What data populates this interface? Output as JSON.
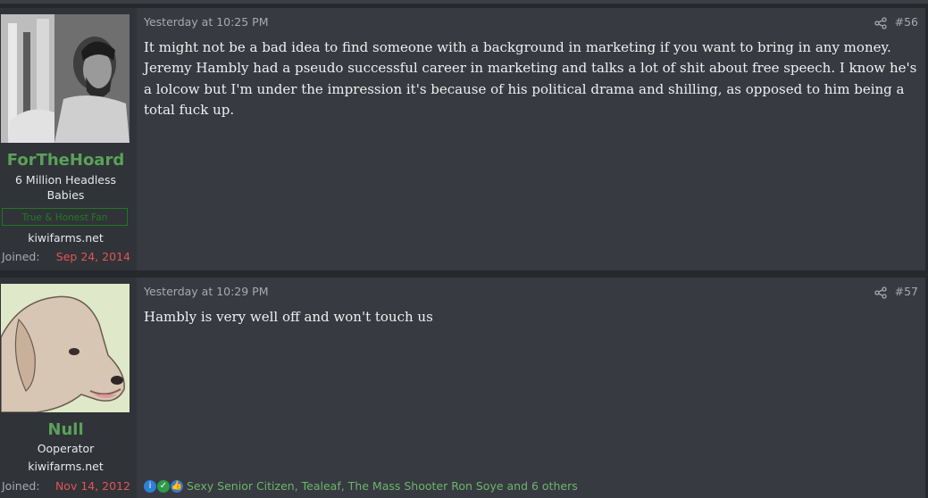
{
  "posts": [
    {
      "date": "Yesterday at 10:25 PM",
      "number": "#56",
      "username": "ForTheHoard",
      "user_title": "6 Million Headless Babies",
      "banner": "True & Honest Fan",
      "site": "kiwifarms.net",
      "joined_label": "Joined:",
      "joined_date": "Sep 24, 2014",
      "body": "It might not be a bad idea to find someone with a background in marketing if you want to bring in any money. Jeremy Hambly had a pseudo successful career in marketing and talks a lot of shit about free speech. I know he's a lolcow but I'm under the impression it's because of his political drama and shilling, as opposed to him being a total fuck up."
    },
    {
      "date": "Yesterday at 10:29 PM",
      "number": "#57",
      "username": "Null",
      "user_title": "Ooperator",
      "site": "kiwifarms.net",
      "joined_label": "Joined:",
      "joined_date": "Nov 14, 2012",
      "body": "Hambly is very well off and won't touch us",
      "reactions_text": "Sexy Senior Citizen, Tealeaf, The Mass Shooter Ron Soye and 6 others",
      "reaction_icons": [
        "informative-icon",
        "agree-icon",
        "like-icon"
      ]
    }
  ],
  "colors": {
    "username": "#5aa25a",
    "joined_date": "#e05555",
    "reactions": "#6cb46c"
  }
}
